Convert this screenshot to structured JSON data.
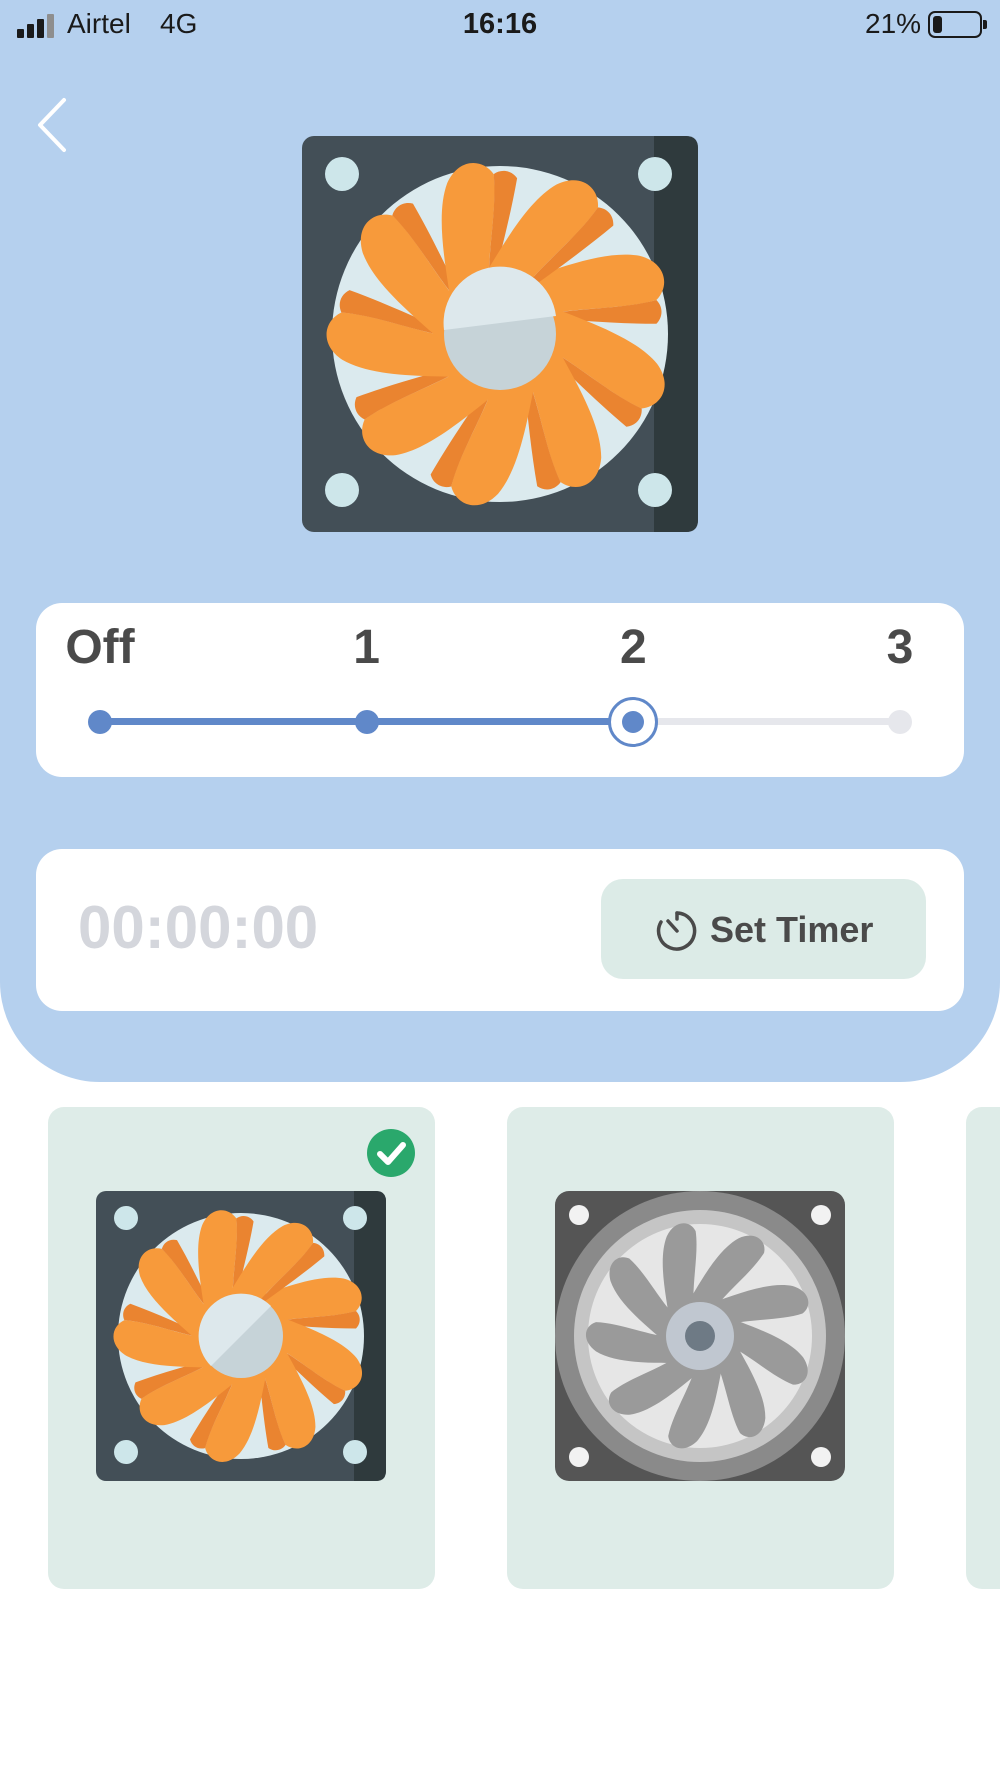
{
  "status_bar": {
    "carrier": "Airtel",
    "network": "4G",
    "time": "16:16",
    "battery_percent": "21%",
    "battery_level": 0.21
  },
  "header": {
    "back_icon": "chevron-left-icon",
    "hero_image": "cpu-fan-orange-icon"
  },
  "speed_selector": {
    "levels": [
      "Off",
      "1",
      "2",
      "3"
    ],
    "selected_index": 2,
    "active_color": "#6088c9",
    "inactive_color": "#e6e7ec"
  },
  "timer": {
    "display": "00:00:00",
    "button_label": "Set Timer",
    "button_icon": "timer-icon"
  },
  "fan_styles": [
    {
      "icon": "cpu-fan-orange-icon",
      "selected": true
    },
    {
      "icon": "cpu-fan-gray-icon",
      "selected": false
    }
  ],
  "colors": {
    "panel": "#b5d0ee",
    "card": "#ffffff",
    "style_card": "#deece8",
    "check": "#2aa86c",
    "fan_orange": "#f79a3b"
  }
}
